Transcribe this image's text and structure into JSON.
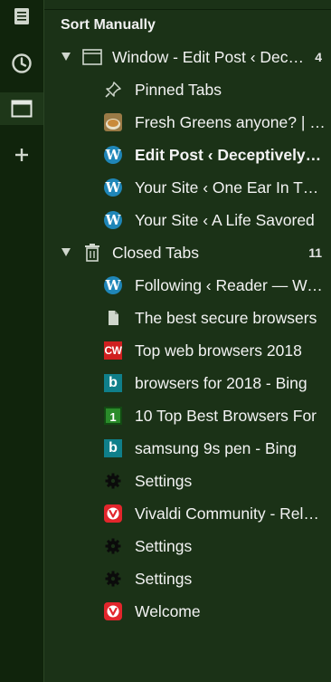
{
  "rail": {
    "items": [
      {
        "icon": "notes-icon"
      },
      {
        "icon": "history-icon"
      },
      {
        "icon": "window-icon",
        "active": true
      },
      {
        "icon": "add-icon"
      }
    ]
  },
  "panel": {
    "sort_label": "Sort Manually",
    "groups": [
      {
        "label": "Window - Edit Post ‹ Deceptively Simple — WordPress",
        "count": "4",
        "icon": "window-icon",
        "tabs": [
          {
            "label": "Pinned Tabs",
            "icon": "pin-icon",
            "bold": false
          },
          {
            "label": "Fresh Greens anyone? | Recipes",
            "icon": "food-favicon",
            "bold": false
          },
          {
            "label": "Edit Post ‹ Deceptively Simple — WordPress",
            "icon": "wordpress-favicon",
            "bold": true
          },
          {
            "label": "Your Site ‹ One Ear In The Clouds",
            "icon": "wordpress-favicon",
            "bold": false
          },
          {
            "label": "Your Site ‹ A Life Savored",
            "icon": "wordpress-favicon",
            "bold": false
          }
        ]
      },
      {
        "label": "Closed Tabs",
        "count": "11",
        "icon": "trash-icon",
        "tabs": [
          {
            "label": "Following ‹ Reader — WordPress.com",
            "icon": "wordpress-favicon",
            "bold": false
          },
          {
            "label": "The best secure browsers",
            "icon": "page-icon",
            "bold": false
          },
          {
            "label": "Top web browsers 2018",
            "icon": "cw-favicon",
            "bold": false
          },
          {
            "label": "browsers for 2018 - Bing",
            "icon": "bing-favicon",
            "bold": false
          },
          {
            "label": "10 Top Best Browsers For",
            "icon": "ten-favicon",
            "bold": false
          },
          {
            "label": "samsung 9s pen - Bing",
            "icon": "bing-favicon",
            "bold": false
          },
          {
            "label": "Settings",
            "icon": "gear-icon",
            "bold": false
          },
          {
            "label": "Vivaldi Community - Release",
            "icon": "vivaldi-favicon",
            "bold": false
          },
          {
            "label": "Settings",
            "icon": "gear-icon",
            "bold": false
          },
          {
            "label": "Settings",
            "icon": "gear-icon",
            "bold": false
          },
          {
            "label": "Welcome",
            "icon": "vivaldi-favicon",
            "bold": false
          }
        ]
      }
    ]
  },
  "colors": {
    "rail_bg": "#10240c",
    "panel_bg": "#1b3217",
    "wordpress": "#1f86b8",
    "bing": "#0f7f8a",
    "vivaldi": "#e2262c"
  }
}
